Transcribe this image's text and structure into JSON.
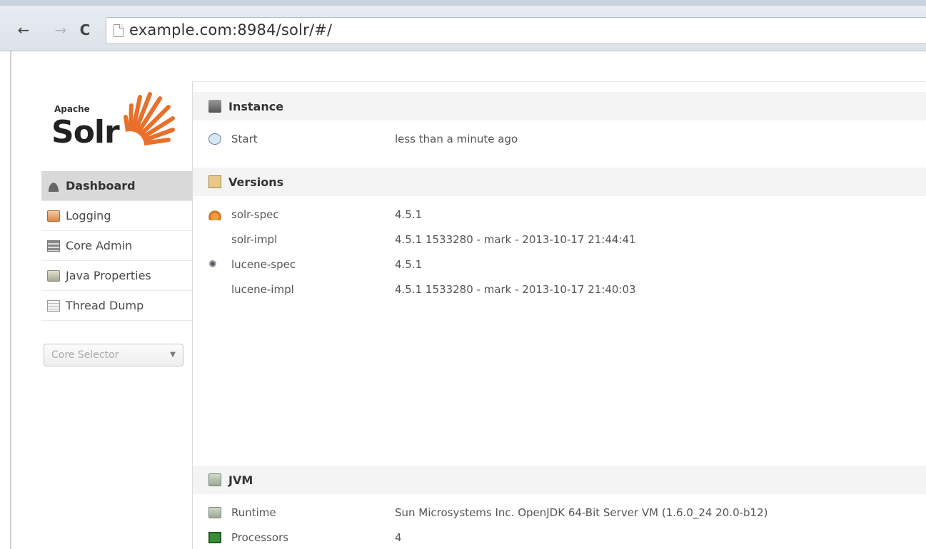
{
  "browser": {
    "url": "example.com:8984/solr/#/",
    "back_glyph": "←",
    "forward_glyph": "→",
    "reload_glyph": "C"
  },
  "logo": {
    "apache": "Apache",
    "solr": "Solr"
  },
  "sidebar": {
    "items": [
      {
        "label": "Dashboard",
        "icon": "dashboard-icon",
        "active": true
      },
      {
        "label": "Logging",
        "icon": "logging-icon",
        "active": false
      },
      {
        "label": "Core Admin",
        "icon": "core-admin-icon",
        "active": false
      },
      {
        "label": "Java Properties",
        "icon": "java-properties-icon",
        "active": false
      },
      {
        "label": "Thread Dump",
        "icon": "thread-dump-icon",
        "active": false
      }
    ],
    "core_selector": {
      "placeholder": "Core Selector"
    }
  },
  "instance": {
    "title": "Instance",
    "start_label": "Start",
    "start_value": "less than a minute ago"
  },
  "versions": {
    "title": "Versions",
    "rows": [
      {
        "key": "solr-spec",
        "value": "4.5.1"
      },
      {
        "key": "solr-impl",
        "value": "4.5.1 1533280 - mark - 2013-10-17 21:44:41"
      },
      {
        "key": "lucene-spec",
        "value": "4.5.1"
      },
      {
        "key": "lucene-impl",
        "value": "4.5.1 1533280 - mark - 2013-10-17 21:40:03"
      }
    ]
  },
  "jvm": {
    "title": "JVM",
    "runtime_label": "Runtime",
    "runtime_value": "Sun Microsystems Inc. OpenJDK 64-Bit Server VM (1.6.0_24 20.0-b12)",
    "processors_label": "Processors",
    "processors_value": "4"
  },
  "colors": {
    "active_menu_bg": "#d9d9d9",
    "section_header_bg": "#f4f4f4",
    "logo_sun_orange": "#e8702a"
  }
}
